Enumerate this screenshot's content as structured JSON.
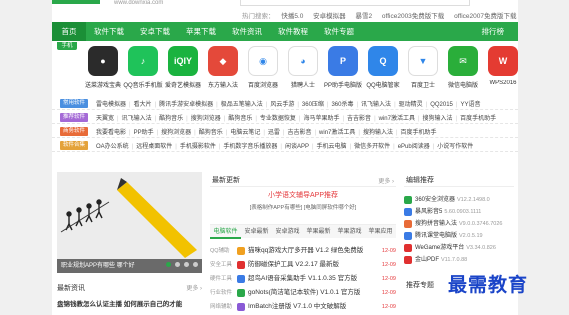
{
  "header": {
    "logo_url": "www.downxia.com",
    "hot_label": "热门搜索：",
    "hot": [
      "快播5.0",
      "安卓模拟器",
      "暴雪2",
      "office2003免费版下载",
      "office2007免费版下载"
    ]
  },
  "nav": {
    "items": [
      "首页",
      "软件下载",
      "安卓下载",
      "苹果下载",
      "软件资讯",
      "软件教程",
      "软件专题"
    ],
    "rank": "排行榜"
  },
  "apps": {
    "tag": "手机",
    "items": [
      {
        "name": "送菜游戏宝典",
        "glyph": "●",
        "color": "#2b2b2b"
      },
      {
        "name": "QQ音乐手机版",
        "glyph": "♪",
        "color": "#1fc35a"
      },
      {
        "name": "爱奇艺模拟器",
        "glyph": "iQIY",
        "color": "#1ab33f"
      },
      {
        "name": "东方输入法",
        "glyph": "◆",
        "color": "#e4493a"
      },
      {
        "name": "百度浏览器",
        "glyph": "◉",
        "color": "#fff"
      },
      {
        "name": "猎聘人士",
        "glyph": "◕",
        "color": "#fff"
      },
      {
        "name": "PP助手电脑版",
        "glyph": "P",
        "color": "#3a7be5"
      },
      {
        "name": "QQ电脑管家",
        "glyph": "Q",
        "color": "#2f86e9"
      },
      {
        "name": "百度卫士",
        "glyph": "▼",
        "color": "#fff"
      },
      {
        "name": "微信电脑版",
        "glyph": "✉",
        "color": "#2aae3a"
      },
      {
        "name": "WPS2016",
        "glyph": "W",
        "color": "#e43b32"
      }
    ]
  },
  "link_rows": [
    {
      "badge": "常用软件",
      "color": "#4a8fe0",
      "items": [
        "雷电模拟器",
        "看大片",
        "腾讯手游安卓模拟器",
        "极品五笔输入法",
        "风云手游",
        "360压缩",
        "360杀毒",
        "讯飞输入法",
        "驱动精灵",
        "QQ2015",
        "YY语音"
      ]
    },
    {
      "badge": "推荐软件",
      "color": "#a46ad6",
      "items": [
        "天翼宽",
        "讯飞输入法",
        "酷狗音乐",
        "搜狗浏览器",
        "酷狗音乐",
        "专业数据恢复",
        "海马苹果助手",
        "吉吉影音",
        "win7激活工具",
        "搜狗输入法",
        "百度手机助手"
      ]
    },
    {
      "badge": "商务软件",
      "color": "#e86b38",
      "items": [
        "我要看电影",
        "PP助手",
        "搜狗浏览器",
        "酷狗音乐",
        "电脑云笔记",
        "迅雷",
        "吉吉影音",
        "win7激活工具",
        "搜狗输入法",
        "百度手机助手"
      ]
    },
    {
      "badge": "软件合集",
      "color": "#e4a23a",
      "items": [
        "OA办公系统",
        "远程桌面软件",
        "手机摄影软件",
        "手机数字音乐播放器",
        "闲谈APP",
        "手机云电脑",
        "微信多开软件",
        "ePub阅读器",
        "小说写作软件"
      ]
    }
  ],
  "banner": {
    "caption": "职业规划APP有哪些 哪个好"
  },
  "news_left": {
    "title": "最新资讯",
    "more": "更多 ›",
    "headline": "盘锦钱教怎么认证主播 如何展示自己的才能"
  },
  "latest": {
    "title": "最新更新",
    "more": "更多 ›",
    "recommend_title": "小学语文辅导APP推荐",
    "recommend_sub": "[表格制作APP有哪些] [电脑同屏软件哪个好]",
    "tabs": [
      "电脑软件",
      "安卓最新",
      "安卓游戏",
      "苹果最新",
      "苹果游戏",
      "苹果应用"
    ],
    "rows": [
      {
        "cat": "QQ辅助",
        "name": "猫咪qq游戏大厅多开器 V1.2 绿色免费版",
        "date": "12-09",
        "color": "#f0a020"
      },
      {
        "cat": "安全工具",
        "name": "防御磁保护工具 V2.2.17 最新版",
        "date": "12-09",
        "color": "#e03030"
      },
      {
        "cat": "硬件工具",
        "name": "超鸟AI语音采集助手 V1.1.0.35 官方版",
        "date": "12-09",
        "color": "#3a7be5"
      },
      {
        "cat": "行业软件",
        "name": "goNots(简洁笔记本软件) V1.0.1 官方版",
        "date": "12-09",
        "color": "#2aa84a"
      },
      {
        "cat": "网络辅助",
        "name": "ImBatch注册版 V7.1.0 中文破解版",
        "date": "12-09",
        "color": "#8a5ad6"
      }
    ]
  },
  "editor": {
    "title": "编辑推荐",
    "rows": [
      {
        "name": "360安全浏览器",
        "ver": "V12.2.1498.0",
        "color": "#2aa84a"
      },
      {
        "name": "暴风影音5",
        "ver": "5.60.0903.1111",
        "color": "#3a7be5"
      },
      {
        "name": "搜狗拼音输入法",
        "ver": "V9.0.0.3746.7026",
        "color": "#e86b38"
      },
      {
        "name": "腾讯课堂电脑版",
        "ver": "V2.0.5.19",
        "color": "#3a7be5"
      },
      {
        "name": "WeGame游戏平台",
        "ver": "V3.34.0.826",
        "color": "#e03030"
      },
      {
        "name": "金山PDF",
        "ver": "V11.7.0.88",
        "color": "#e03030"
      }
    ],
    "more_title": "推荐专题"
  },
  "watermark": "最需教育"
}
